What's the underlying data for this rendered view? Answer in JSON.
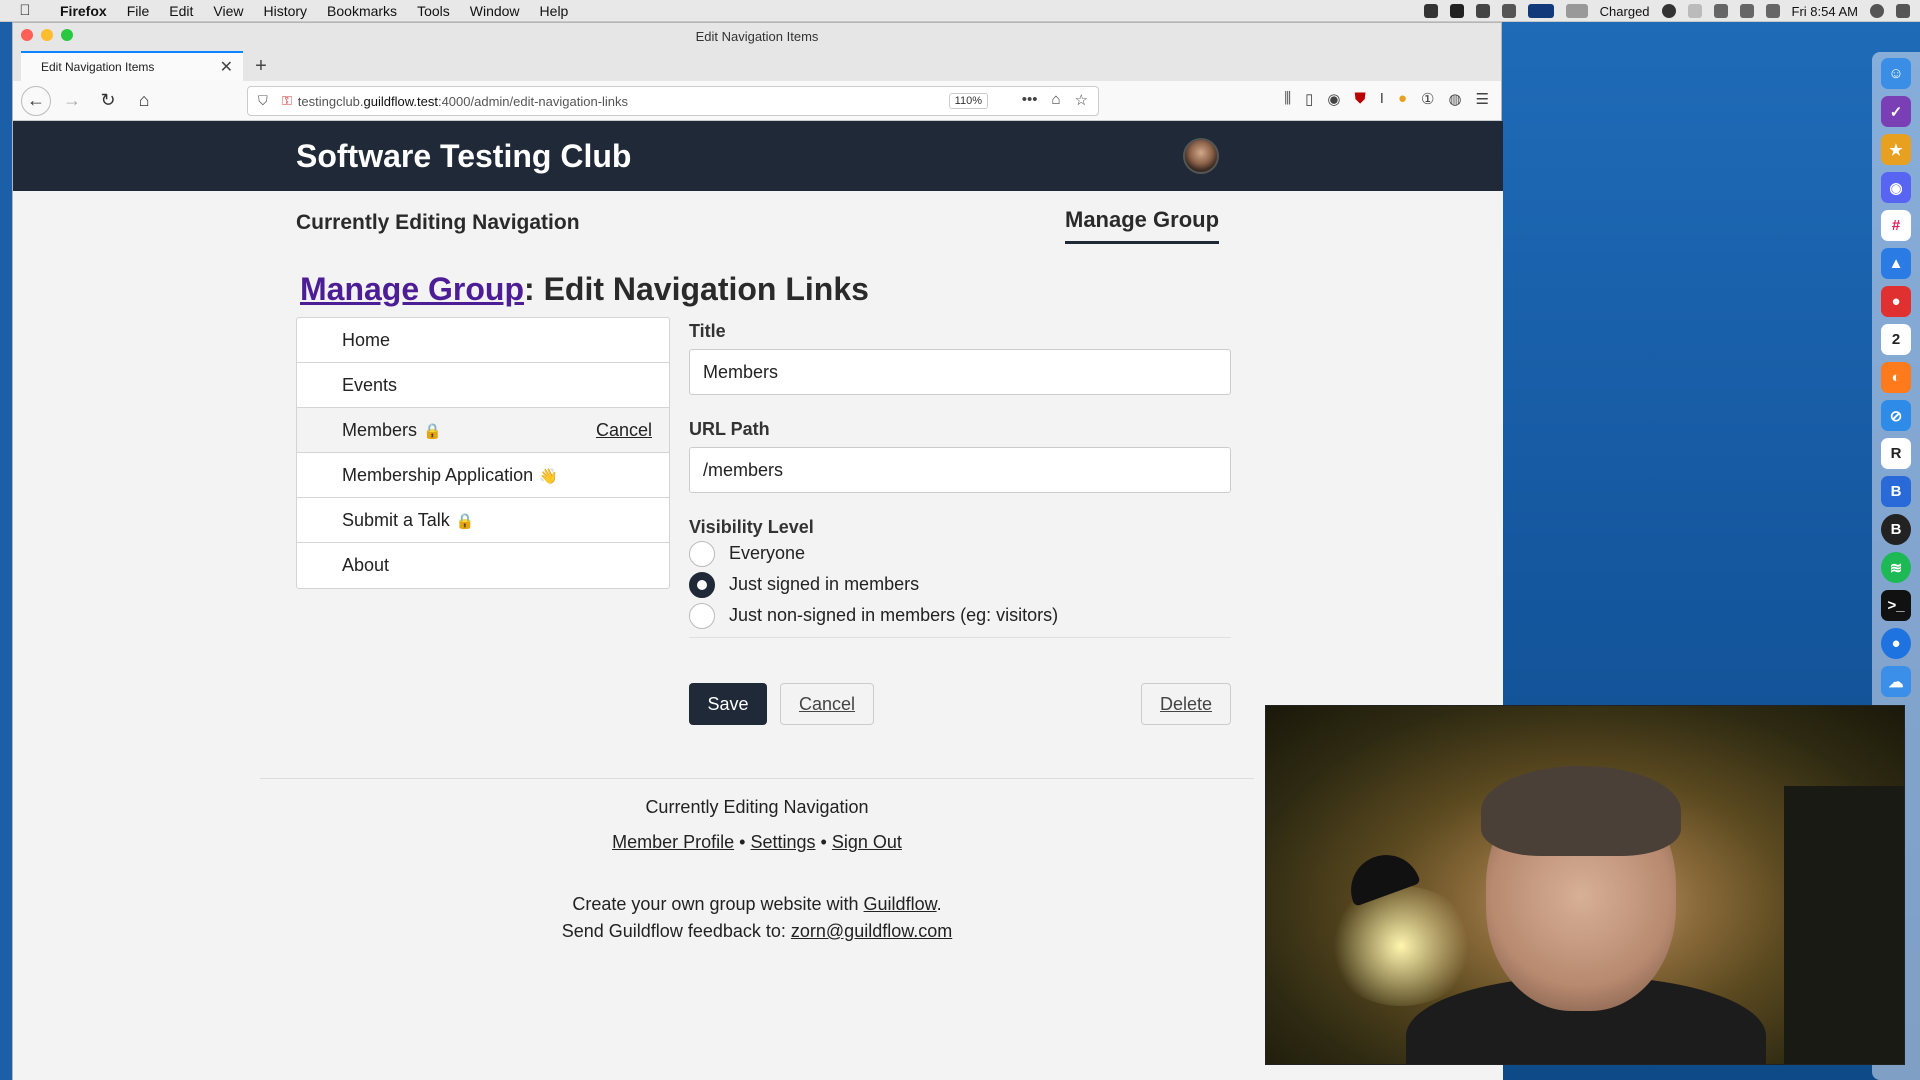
{
  "menubar": {
    "app": "Firefox",
    "items": [
      "File",
      "Edit",
      "View",
      "History",
      "Bookmarks",
      "Tools",
      "Window",
      "Help"
    ],
    "battery": "Charged",
    "clock": "Fri 8:54 AM"
  },
  "browser": {
    "window_title": "Edit Navigation Items",
    "tab_title": "Edit Navigation Items",
    "url_host_prefix": "testingclub.",
    "url_host_main": "guildflow.test",
    "url_rest": ":4000/admin/edit-navigation-links",
    "zoom": "110%"
  },
  "site": {
    "title": "Software Testing Club",
    "subnav_left": "Currently Editing Navigation",
    "subnav_right": "Manage Group"
  },
  "heading": {
    "link": "Manage Group",
    "rest": ": Edit Navigation Links"
  },
  "nav_items": [
    {
      "label": "Home",
      "emoji": ""
    },
    {
      "label": "Events",
      "emoji": ""
    },
    {
      "label": "Members",
      "emoji": "🔒",
      "action": "Cancel"
    },
    {
      "label": "Membership Application",
      "emoji": "👋"
    },
    {
      "label": "Submit a Talk",
      "emoji": "🔒"
    },
    {
      "label": "About",
      "emoji": ""
    }
  ],
  "form": {
    "title_label": "Title",
    "title_value": "Members",
    "url_label": "URL Path",
    "url_value": "/members",
    "visibility_label": "Visibility Level",
    "options": [
      "Everyone",
      "Just signed in members",
      "Just non-signed in members (eg: visitors)"
    ],
    "selected_option": "Just signed in members"
  },
  "buttons": {
    "save": "Save",
    "cancel": "Cancel",
    "delete": "Delete"
  },
  "footer": {
    "line1": "Currently Editing Navigation",
    "links": [
      "Member Profile",
      "Settings",
      "Sign Out"
    ],
    "sep": "•",
    "create_text": "Create your own group website with ",
    "create_link": "Guildflow",
    "create_end": ".",
    "feedback_text": "Send Guildflow feedback to: ",
    "feedback_link": "zorn@guildflow.com"
  },
  "dock_icons": [
    "finder-icon",
    "omnifocus-icon",
    "reeder-icon",
    "discord-icon",
    "slack-icon",
    "navigation-icon",
    "red-app-icon",
    "calendar-icon",
    "firefox-icon",
    "safari-icon",
    "rstudio-icon",
    "bbedit-icon",
    "b-app-icon",
    "spotify-icon",
    "terminal-icon",
    "maps-icon",
    "cloud-icon"
  ]
}
